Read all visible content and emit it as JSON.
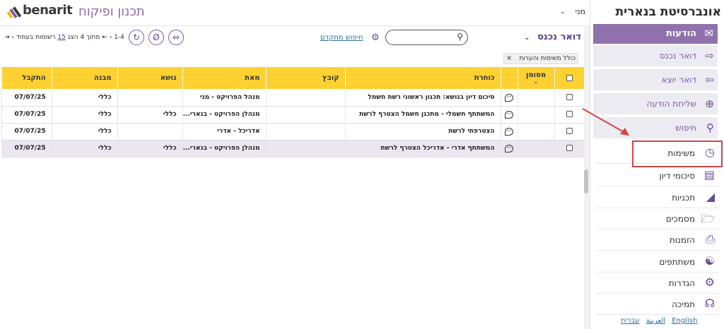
{
  "brand": {
    "name": "benarit",
    "app_title": "תכנון ופיקוח"
  },
  "user": {
    "name": "מני"
  },
  "toolbar": {
    "folder_title": "דואר נכנס",
    "search_placeholder": "",
    "advanced_search_label": "חיפוש מתקדם",
    "pager": {
      "range": "1-4",
      "of_label": "מתוך",
      "total": "4",
      "show_label": "הצג",
      "per_page": "15",
      "per_page_suffix": "רשומות בעמוד"
    }
  },
  "filters": {
    "include_tasks_label": "כולל משימות והערות"
  },
  "table": {
    "headers": {
      "flag": "מסומן",
      "title": "כותרת",
      "file": "קובץ",
      "from": "מאת",
      "subject": "נושא",
      "structure": "מבנה",
      "received": "התקבל"
    },
    "rows": [
      {
        "title": "סיכום דיון בנושא: תכנון ראשוני רשת חשמל",
        "file": "",
        "from": "מנהל הפרויקט - מני",
        "subject": "",
        "structure": "כללי",
        "received": "07/07/25",
        "highlighted": false
      },
      {
        "title": "המשתתף חשמלי - מתכנן חשמל הצטרף לרשת",
        "file": "",
        "from": "מנהלן הפרויקט - בנארי...",
        "subject": "כללי",
        "structure": "כללי",
        "received": "07/07/25",
        "highlighted": false
      },
      {
        "title": "הצטרפתי לרשת",
        "file": "",
        "from": "אדריכל - אדרי",
        "subject": "",
        "structure": "כללי",
        "received": "07/07/25",
        "highlighted": false
      },
      {
        "title": "המשתתף אדרי - אדריכל הצטרף לרשת",
        "file": "",
        "from": "מנהלן הפרויקט - בנארי...",
        "subject": "כללי",
        "structure": "כללי",
        "received": "07/07/25",
        "highlighted": true
      }
    ]
  },
  "sidebar": {
    "org_name": "אונברסיטת בנארית",
    "messages_label": "הודעות",
    "message_subitems": [
      {
        "label": "דואר נכנס",
        "icon": "inbox-icon"
      },
      {
        "label": "דואר יוצא",
        "icon": "outbox-icon"
      },
      {
        "label": "שליחת הודעה",
        "icon": "plus-icon"
      },
      {
        "label": "חיפוש",
        "icon": "search-icon"
      }
    ],
    "nav_items": [
      {
        "label": "משימות",
        "icon": "clock-icon"
      },
      {
        "label": "סיכומי דיון",
        "icon": "document-icon"
      },
      {
        "label": "תכניות",
        "icon": "ruler-icon"
      },
      {
        "label": "מסמכים",
        "icon": "folder-icon"
      },
      {
        "label": "הזמנות",
        "icon": "printer-icon"
      },
      {
        "label": "משתתפים",
        "icon": "person-icon"
      },
      {
        "label": "הגדרות",
        "icon": "gear-icon"
      },
      {
        "label": "תמיכה",
        "icon": "headset-icon"
      }
    ],
    "languages": [
      "English",
      "עברית",
      "العربية"
    ]
  },
  "colors": {
    "accent": "#8f72ad",
    "header_yellow": "#fdd131",
    "highlight": "#d24646"
  }
}
